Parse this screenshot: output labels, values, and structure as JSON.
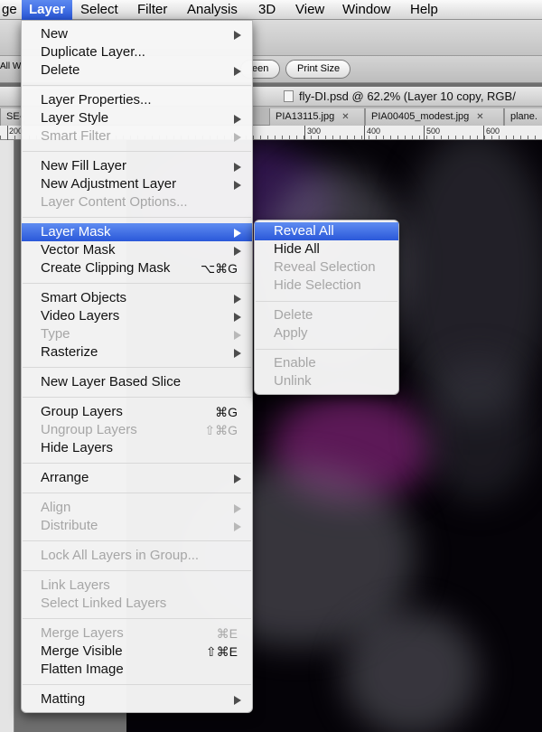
{
  "menubar": {
    "items": [
      {
        "label": "ge"
      },
      {
        "label": "Layer"
      },
      {
        "label": "Select"
      },
      {
        "label": "Filter"
      },
      {
        "label": "Analysis"
      },
      {
        "label": "3D"
      },
      {
        "label": "View"
      },
      {
        "label": "Window"
      },
      {
        "label": "Help"
      }
    ]
  },
  "options": {
    "left_text": "All W",
    "pill_screen": "een",
    "pill_print": "Print Size"
  },
  "document": {
    "title": "fly-DI.psd @ 62.2% (Layer 10 copy, RGB/"
  },
  "tabs": [
    {
      "label": "SE-"
    },
    {
      "label": "PIA13115.jpg"
    },
    {
      "label": "PIA00405_modest.jpg"
    },
    {
      "label": "plane."
    }
  ],
  "tab_close": "✕",
  "ruler": {
    "numbers": [
      "200",
      "300",
      "400",
      "500",
      "600"
    ]
  },
  "layer_menu": {
    "items": [
      {
        "label": "New",
        "arrow": true
      },
      {
        "label": "Duplicate Layer..."
      },
      {
        "label": "Delete",
        "arrow": true
      },
      {
        "label": "Layer Properties..."
      },
      {
        "label": "Layer Style",
        "arrow": true
      },
      {
        "label": "Smart Filter",
        "arrow": true,
        "disabled": true
      },
      {
        "label": "New Fill Layer",
        "arrow": true
      },
      {
        "label": "New Adjustment Layer",
        "arrow": true
      },
      {
        "label": "Layer Content Options...",
        "disabled": true
      },
      {
        "label": "Layer Mask",
        "arrow": true,
        "highlighted": true
      },
      {
        "label": "Vector Mask",
        "arrow": true
      },
      {
        "label": "Create Clipping Mask",
        "shortcut": "⌥⌘G"
      },
      {
        "label": "Smart Objects",
        "arrow": true
      },
      {
        "label": "Video Layers",
        "arrow": true
      },
      {
        "label": "Type",
        "arrow": true,
        "disabled": true
      },
      {
        "label": "Rasterize",
        "arrow": true
      },
      {
        "label": "New Layer Based Slice"
      },
      {
        "label": "Group Layers",
        "shortcut": "⌘G"
      },
      {
        "label": "Ungroup Layers",
        "shortcut": "⇧⌘G",
        "disabled": true
      },
      {
        "label": "Hide Layers"
      },
      {
        "label": "Arrange",
        "arrow": true
      },
      {
        "label": "Align",
        "arrow": true,
        "disabled": true
      },
      {
        "label": "Distribute",
        "arrow": true,
        "disabled": true
      },
      {
        "label": "Lock All Layers in Group...",
        "disabled": true
      },
      {
        "label": "Link Layers",
        "disabled": true
      },
      {
        "label": "Select Linked Layers",
        "disabled": true
      },
      {
        "label": "Merge Layers",
        "shortcut": "⌘E",
        "disabled": true
      },
      {
        "label": "Merge Visible",
        "shortcut": "⇧⌘E"
      },
      {
        "label": "Flatten Image"
      },
      {
        "label": "Matting",
        "arrow": true
      }
    ]
  },
  "layer_mask_submenu": {
    "items": [
      {
        "label": "Reveal All",
        "highlighted": true
      },
      {
        "label": "Hide All"
      },
      {
        "label": "Reveal Selection",
        "disabled": true
      },
      {
        "label": "Hide Selection",
        "disabled": true
      },
      {
        "label": "Delete",
        "disabled": true
      },
      {
        "label": "Apply",
        "disabled": true
      },
      {
        "label": "Enable",
        "disabled": true
      },
      {
        "label": "Unlink",
        "disabled": true
      }
    ]
  },
  "colors": {
    "highlight": "#2a58d9",
    "disabled_text": "#a6a6a6",
    "canvas": "#050308"
  }
}
